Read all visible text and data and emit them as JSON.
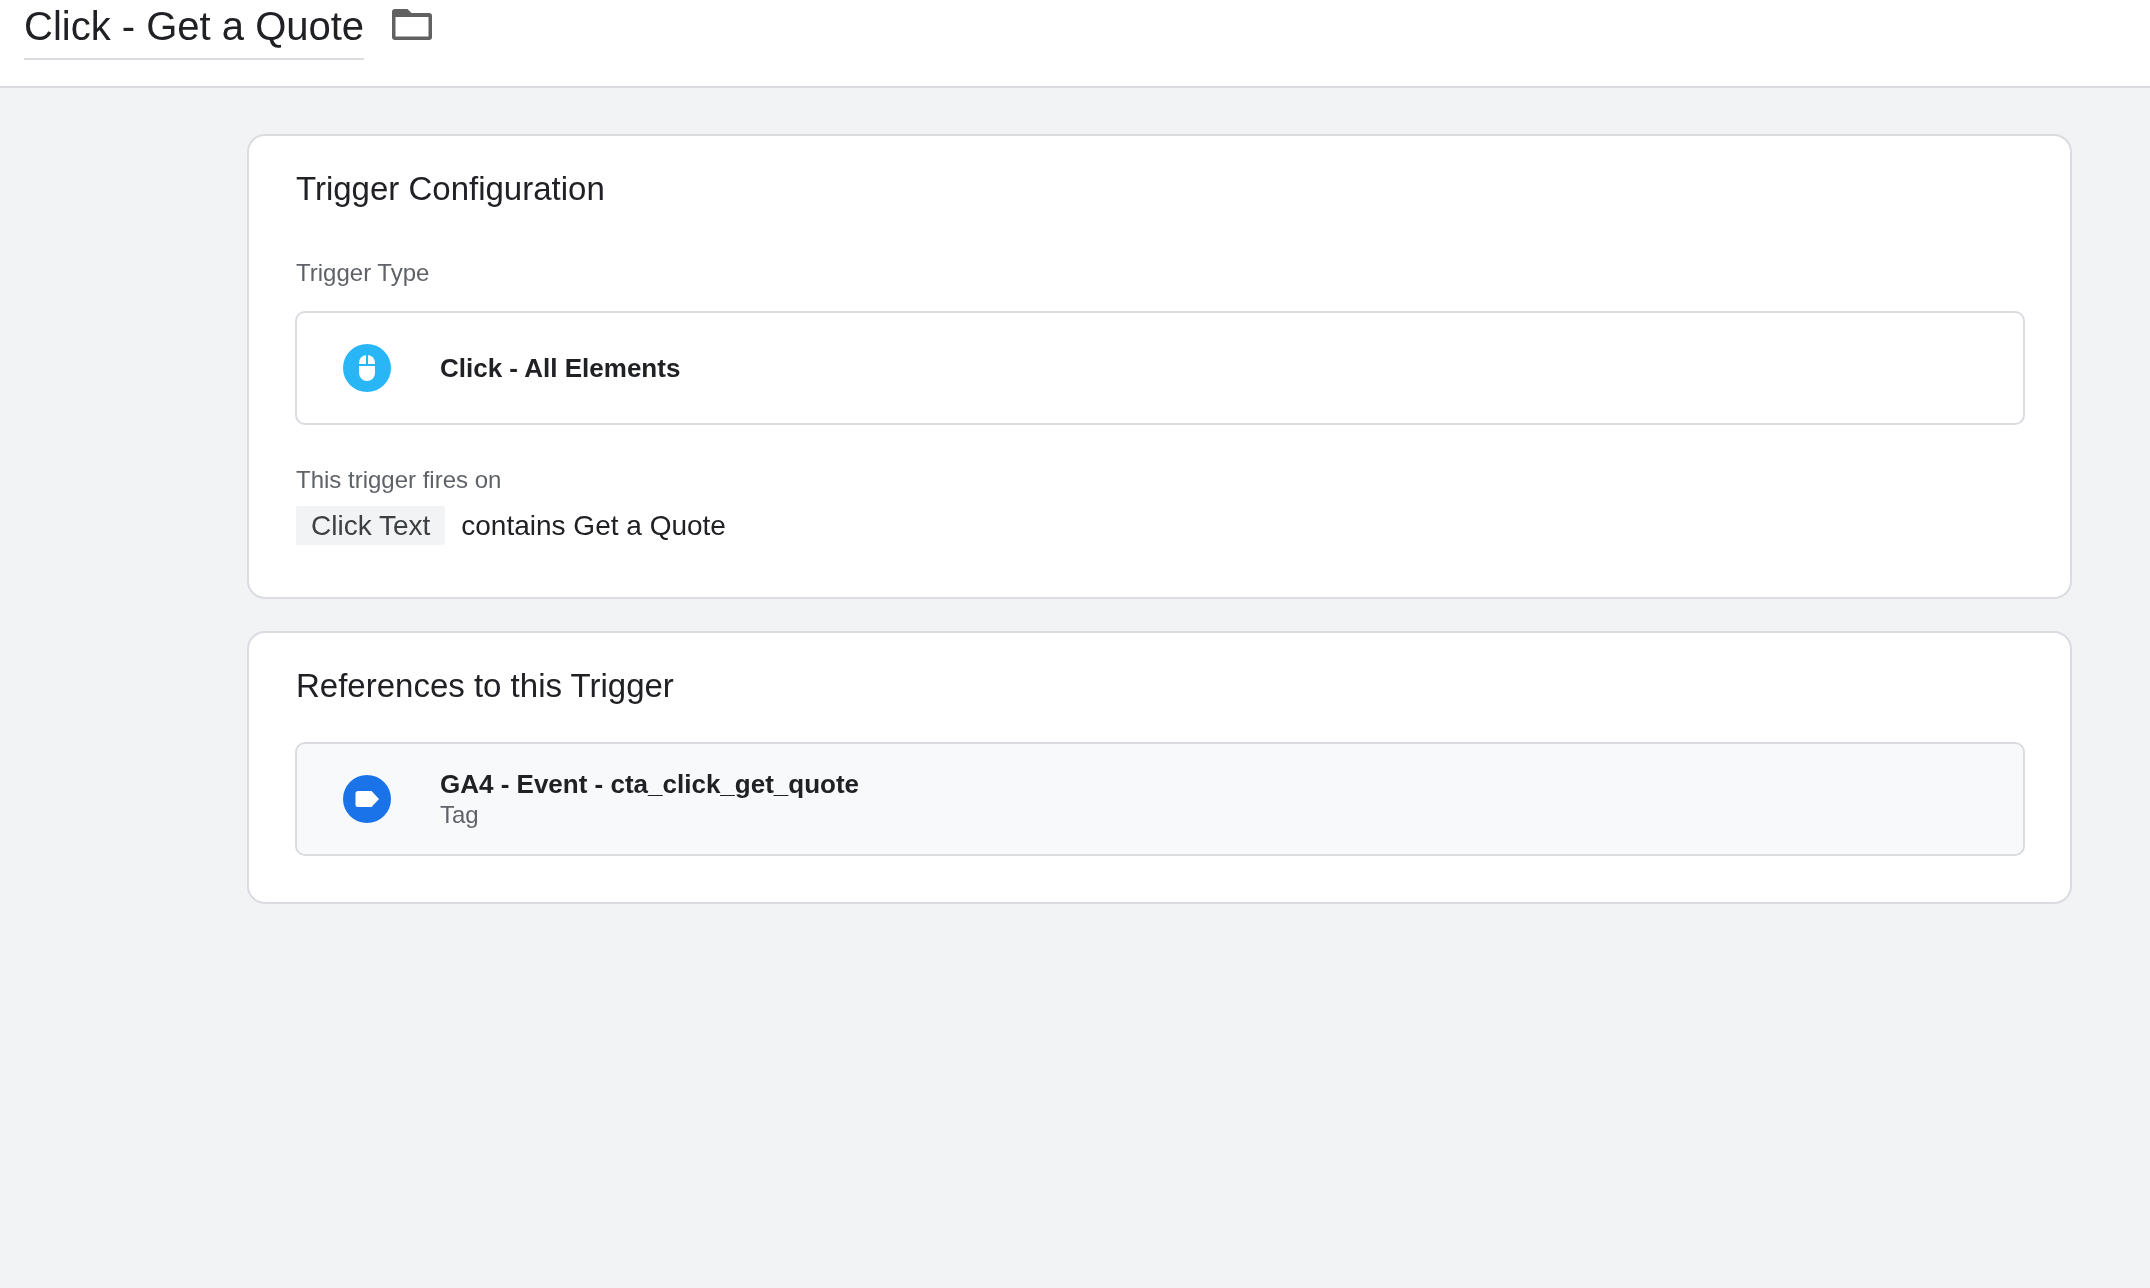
{
  "header": {
    "title": "Click - Get a Quote"
  },
  "trigger_configuration": {
    "title": "Trigger Configuration",
    "type_label": "Trigger Type",
    "trigger_type": "Click - All Elements",
    "fires_on_label": "This trigger fires on",
    "conditions": [
      {
        "variable": "Click Text",
        "condition": "contains Get a Quote"
      }
    ]
  },
  "references": {
    "title": "References to this Trigger",
    "items": [
      {
        "name": "GA4 - Event - cta_click_get_quote",
        "type": "Tag"
      }
    ]
  }
}
